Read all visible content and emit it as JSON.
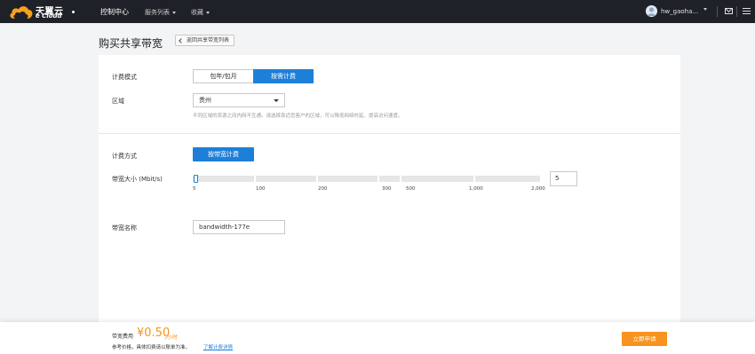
{
  "nav": {
    "logo_cn": "天翼云",
    "logo_en": "e Cloud",
    "console": "控制中心",
    "services": "服务列表",
    "favorites": "收藏",
    "username": "hw_gaoha..."
  },
  "header": {
    "title": "购买共享带宽",
    "back_label": "返回共享带宽列表"
  },
  "billing_mode": {
    "label": "计费模式",
    "options": [
      "包年/包月",
      "按需计费"
    ],
    "selected": "按需计费"
  },
  "region": {
    "label": "区域",
    "value": "贵州",
    "hint": "不同区域的资源之间内网不互通。请选择靠近您客户的区域，可以降低网络时延、提高访问速度。"
  },
  "charge_method": {
    "label": "计费方式",
    "option": "按带宽计费"
  },
  "bandwidth": {
    "label": "带宽大小 (Mbit/s)",
    "value": "5",
    "ticks": [
      "5",
      "100",
      "200",
      "300",
      "500",
      "1,000",
      "2,000"
    ],
    "min": 5,
    "max": 2000
  },
  "bandwidth_name": {
    "label": "带宽名称",
    "value": "bandwidth-177e"
  },
  "footer": {
    "fee_label": "带宽费用",
    "price": "¥0.50",
    "unit": "/小时",
    "note": "参考价格，具体扣费请以账单为准。",
    "link": "了解计费详情",
    "apply": "立即申请"
  },
  "colors": {
    "primary": "#1e7fd8",
    "accent": "#f7931e",
    "nav_bg": "#1e2127"
  }
}
